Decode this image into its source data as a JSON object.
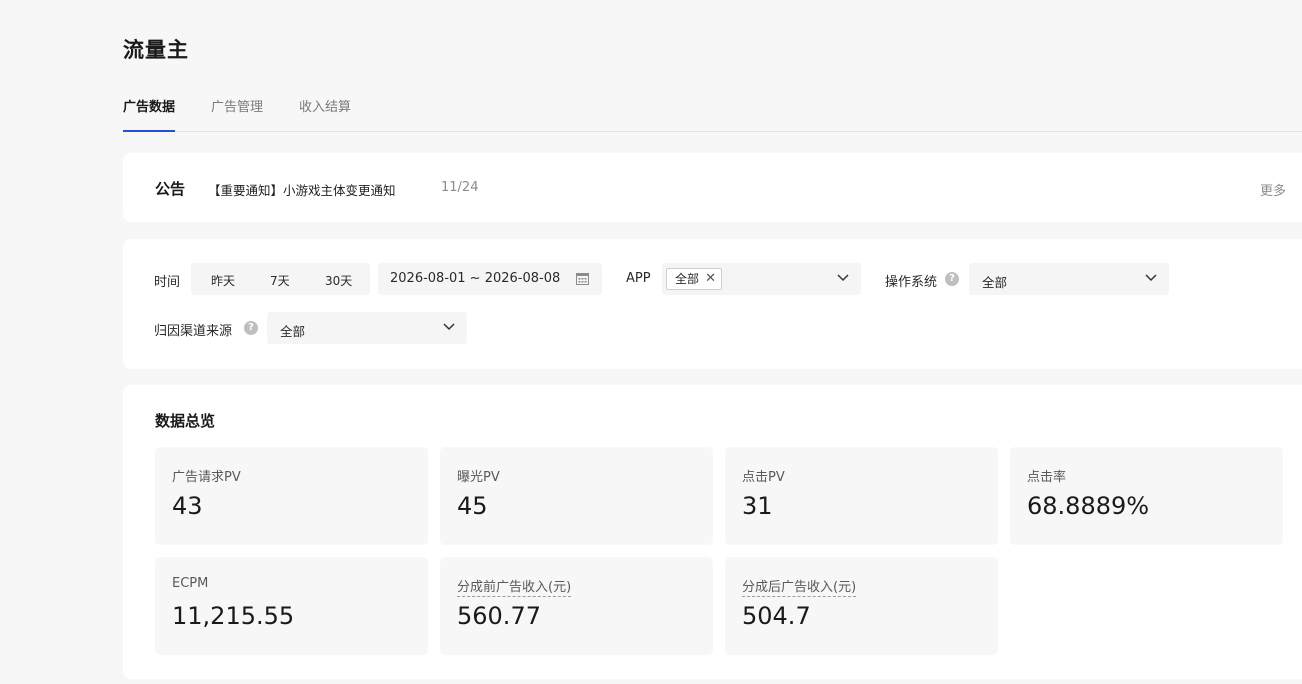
{
  "page": {
    "title": "流量主"
  },
  "tabs": [
    {
      "label": "广告数据",
      "active": true
    },
    {
      "label": "广告管理",
      "active": false
    },
    {
      "label": "收入结算",
      "active": false
    }
  ],
  "notice": {
    "label": "公告",
    "title": "【重要通知】小游戏主体变更通知",
    "date": "11/24",
    "more": "更多"
  },
  "filters": {
    "time_label": "时间",
    "quick_ranges": [
      "昨天",
      "7天",
      "30天"
    ],
    "date_range": "2026-08-01 ~ 2026-08-08",
    "app_label": "APP",
    "app_tag": "全部",
    "os_label": "操作系统",
    "os_value": "全部",
    "channel_label": "归因渠道来源",
    "channel_value": "全部",
    "help_glyph": "?"
  },
  "overview": {
    "title": "数据总览",
    "metrics": [
      {
        "label": "广告请求PV",
        "value": "43"
      },
      {
        "label": "曝光PV",
        "value": "45"
      },
      {
        "label": "点击PV",
        "value": "31"
      },
      {
        "label": "点击率",
        "value": "68.8889%"
      },
      {
        "label": "ECPM",
        "value": "11,215.55"
      },
      {
        "label": "分成前广告收入(元)",
        "value": "560.77"
      },
      {
        "label": "分成后广告收入(元)",
        "value": "504.7"
      }
    ]
  },
  "icons": {
    "calendar": "calendar-icon",
    "chevron": "chevron-down-icon",
    "close": "close-icon",
    "help": "help-icon"
  },
  "colors": {
    "accent": "#1f4fd6",
    "background": "#f7f7f7",
    "card": "#ffffff"
  }
}
